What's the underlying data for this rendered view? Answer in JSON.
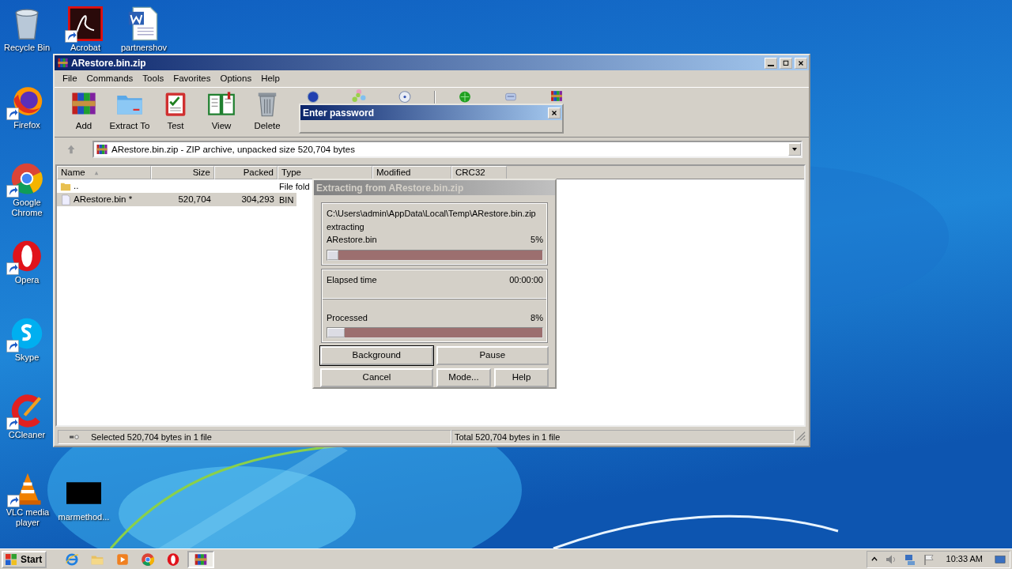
{
  "desktop_icons": [
    {
      "label": "Recycle Bin",
      "kind": "recycle",
      "shortcut": false
    },
    {
      "label": "Acrobat",
      "kind": "acrobat",
      "shortcut": true
    },
    {
      "label": "partnershov",
      "kind": "word",
      "shortcut": false
    },
    {
      "label": "Firefox",
      "kind": "firefox",
      "shortcut": true
    },
    {
      "label": "Google Chrome",
      "kind": "chrome",
      "shortcut": true
    },
    {
      "label": "Opera",
      "kind": "opera",
      "shortcut": true
    },
    {
      "label": "Skype",
      "kind": "skype",
      "shortcut": true
    },
    {
      "label": "CCleaner",
      "kind": "ccleaner",
      "shortcut": true
    },
    {
      "label": "VLC media player",
      "kind": "vlc",
      "shortcut": true
    },
    {
      "label": "marmethod...",
      "kind": "blackfile",
      "shortcut": false
    }
  ],
  "main_window": {
    "title": "ARestore.bin.zip",
    "menu": [
      "File",
      "Commands",
      "Tools",
      "Favorites",
      "Options",
      "Help"
    ],
    "toolbar": {
      "groups": [
        [
          {
            "label": "Add",
            "kind": "books"
          },
          {
            "label": "Extract To",
            "kind": "folder"
          },
          {
            "label": "Test",
            "kind": "clipboard"
          },
          {
            "label": "View",
            "kind": "book"
          },
          {
            "label": "Delete",
            "kind": "trash"
          },
          {
            "kind": "globe"
          },
          {
            "kind": "sparkle"
          },
          {
            "kind": "disc"
          }
        ],
        [
          {
            "kind": "greenball"
          },
          {
            "kind": "note"
          },
          {
            "kind": "books"
          }
        ]
      ]
    },
    "address": "ARestore.bin.zip - ZIP archive, unpacked size 520,704 bytes",
    "columns": [
      {
        "label": "Name",
        "sorted": true
      },
      {
        "label": "Size",
        "sorted": false
      },
      {
        "label": "Packed",
        "sorted": false
      },
      {
        "label": "Type",
        "sorted": false
      },
      {
        "label": "Modified",
        "sorted": false
      },
      {
        "label": "CRC32",
        "sorted": false
      }
    ],
    "rows": [
      {
        "kind": "folder",
        "cells": [
          "..",
          "",
          "",
          "File fold"
        ],
        "selected": false
      },
      {
        "kind": "file",
        "cells": [
          "ARestore.bin *",
          "520,704",
          "304,293",
          "BIN"
        ],
        "selected": true
      }
    ],
    "status_bar": [
      "Selected 520,704 bytes in 1 file",
      "Total 520,704 bytes in 1 file"
    ]
  },
  "password_dialog": {
    "title": "Enter password"
  },
  "progress_dialog": {
    "title": "Extracting from ARestore.bin.zip",
    "path": "C:\\Users\\admin\\AppData\\Local\\Temp\\ARestore.bin.zip",
    "action": "extracting",
    "file_progress": {
      "label": "ARestore.bin",
      "reading": "5%",
      "level": 0.05
    },
    "elapsed": {
      "label": "Elapsed time",
      "reading": "00:00:00"
    },
    "processed": {
      "label": "Processed",
      "reading": "8%",
      "level": 0.08
    },
    "button_rows": [
      [
        {
          "label": "Background",
          "default": true
        },
        {
          "label": "Pause",
          "default": false
        }
      ],
      [
        {
          "label": "Cancel",
          "default": false
        },
        {
          "label": "Mode...",
          "default": false
        },
        {
          "label": "Help",
          "default": false
        }
      ]
    ]
  },
  "taskbar": {
    "start": "Start",
    "apps": [
      {
        "kind": "ie",
        "active": false
      },
      {
        "kind": "explorer",
        "active": false
      },
      {
        "kind": "player",
        "active": false
      },
      {
        "kind": "chrome",
        "active": false
      },
      {
        "kind": "opera",
        "active": false
      },
      {
        "kind": "winrar",
        "active": true
      }
    ],
    "clock": "10:33 AM"
  }
}
